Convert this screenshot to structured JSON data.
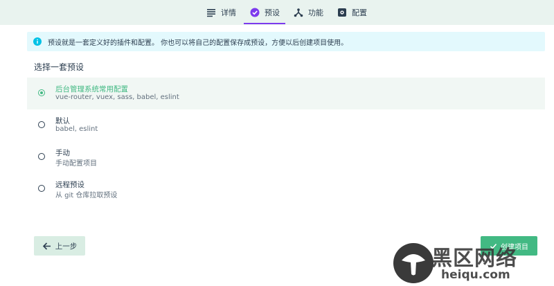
{
  "tabs": [
    {
      "label": "详情",
      "icon": "list-icon"
    },
    {
      "label": "预设",
      "icon": "check-circle-icon",
      "active": true
    },
    {
      "label": "功能",
      "icon": "fork-icon"
    },
    {
      "label": "配置",
      "icon": "settings-icon"
    }
  ],
  "info": {
    "text": "预设就是一套定义好的插件和配置。 你也可以将自己的配置保存成预设，方便以后创建项目使用。"
  },
  "section_title": "选择一套预设",
  "presets": [
    {
      "name": "后台管理系统常用配置",
      "desc": "vue-router, vuex, sass, babel, eslint",
      "selected": true
    },
    {
      "name": "默认",
      "desc": "babel, eslint",
      "selected": false
    },
    {
      "name": "手动",
      "desc": "手动配置项目",
      "selected": false
    },
    {
      "name": "远程预设",
      "desc": "从 git 仓库拉取预设",
      "selected": false
    }
  ],
  "buttons": {
    "back": "上一步",
    "create": "创建项目"
  },
  "watermark": {
    "text": "黑区网络",
    "url": "heiqu.com"
  },
  "colors": {
    "accent": "#42b983",
    "tab_active": "#7c3aed",
    "info_bg": "#e3f9fd",
    "info_icon": "#03c2e6"
  }
}
